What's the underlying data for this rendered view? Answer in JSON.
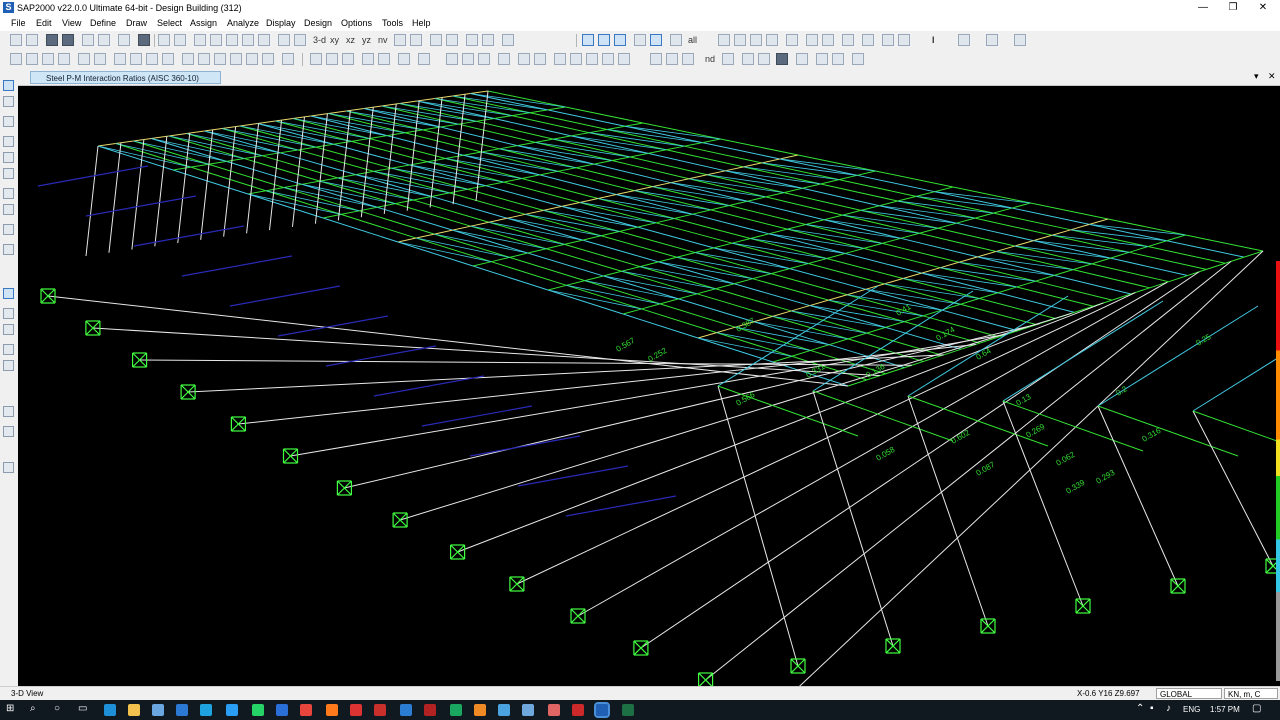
{
  "window": {
    "title": "SAP2000 v22.0.0 Ultimate 64-bit - Design Building (312)",
    "app_icon_letter": "S",
    "minimize_glyph": "—",
    "maximize_glyph": "❐",
    "close_glyph": "✕"
  },
  "menu": [
    "File",
    "Edit",
    "View",
    "Define",
    "Draw",
    "Select",
    "Assign",
    "Analyze",
    "Display",
    "Design",
    "Options",
    "Tools",
    "Help"
  ],
  "toolbar": {
    "view_3d": "3-d",
    "view_xy": "xy",
    "view_xz": "xz",
    "view_yz": "yz",
    "view_nv": "nv",
    "select_all": "all",
    "text_tool": "I",
    "nd_label": "nd"
  },
  "view": {
    "tab_title": "Steel P-M Interaction Ratios  (AISC 360-10)",
    "menu_glyph": "▾",
    "close_glyph": "✕"
  },
  "model": {
    "ratio_labels": [
      "0.567",
      "0.252",
      "0.566",
      "0.331",
      "0.136",
      "0.269",
      "0.64",
      "0.602",
      "0.316",
      "0.339",
      "0.293",
      "0.387",
      "0.174",
      "0.25",
      "0.058",
      "0.13",
      "0.2",
      "0.41",
      "0.087",
      "0.062"
    ]
  },
  "colors": {
    "background": "#000000",
    "frame_green": "#33e033",
    "frame_cyan": "#40c8e0",
    "frame_yellow": "#e6d96a",
    "column_white": "#e8e8e8",
    "foundation_beam_blue": "#2a2ab8",
    "support_green": "#40ff40",
    "ratio_scale": [
      "#e81010",
      "#ff8c00",
      "#f0e020",
      "#22cc22",
      "#33c8e8",
      "#9a9a9a"
    ]
  },
  "status": {
    "view_name": "3-D View",
    "coords": "X-0.6  Y16  Z9.697",
    "coord_system": "GLOBAL",
    "units": "KN, m, C"
  },
  "taskbar": {
    "language": "ENG",
    "time": "1:57 PM"
  }
}
